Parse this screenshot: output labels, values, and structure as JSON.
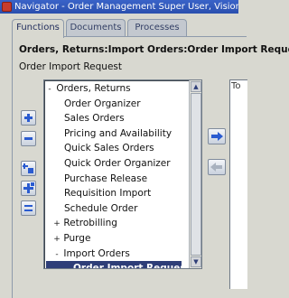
{
  "window": {
    "title": "Navigator - Order Management Super User, Vision Operat"
  },
  "tabs": [
    {
      "label": "Functions",
      "active": true
    },
    {
      "label": "Documents",
      "active": false
    },
    {
      "label": "Processes",
      "active": false
    }
  ],
  "breadcrumb": "Orders, Returns:Import Orders:Order Import Reque",
  "heading": "Order Import Request",
  "tree": {
    "items": [
      {
        "label": "Orders, Returns",
        "expander": "-"
      },
      {
        "label": "Order Organizer",
        "expander": ""
      },
      {
        "label": "Sales Orders",
        "expander": ""
      },
      {
        "label": "Pricing and Availability",
        "expander": ""
      },
      {
        "label": "Quick Sales Orders",
        "expander": ""
      },
      {
        "label": "Quick Order Organizer",
        "expander": ""
      },
      {
        "label": "Purchase Release",
        "expander": ""
      },
      {
        "label": "Requisition Import",
        "expander": ""
      },
      {
        "label": "Schedule Order",
        "expander": ""
      },
      {
        "label": "Retrobilling",
        "expander": "+"
      },
      {
        "label": "Purge",
        "expander": "+"
      },
      {
        "label": "Import Orders",
        "expander": "-"
      },
      {
        "label": "Order Import Request",
        "expander": ""
      }
    ],
    "selected_label": "Order Import Request"
  },
  "top_ten_label": "To",
  "colors": {
    "title_bar": "#2a4fae",
    "selection": "#2e3e78",
    "button_icon": "#2a5bd0",
    "background": "#d8d8d0"
  },
  "icons": [
    "expand-icon",
    "collapse-icon",
    "expand-branch-icon",
    "expand-all-icon",
    "collapse-all-icon",
    "add-to-list-icon",
    "remove-from-list-icon"
  ]
}
